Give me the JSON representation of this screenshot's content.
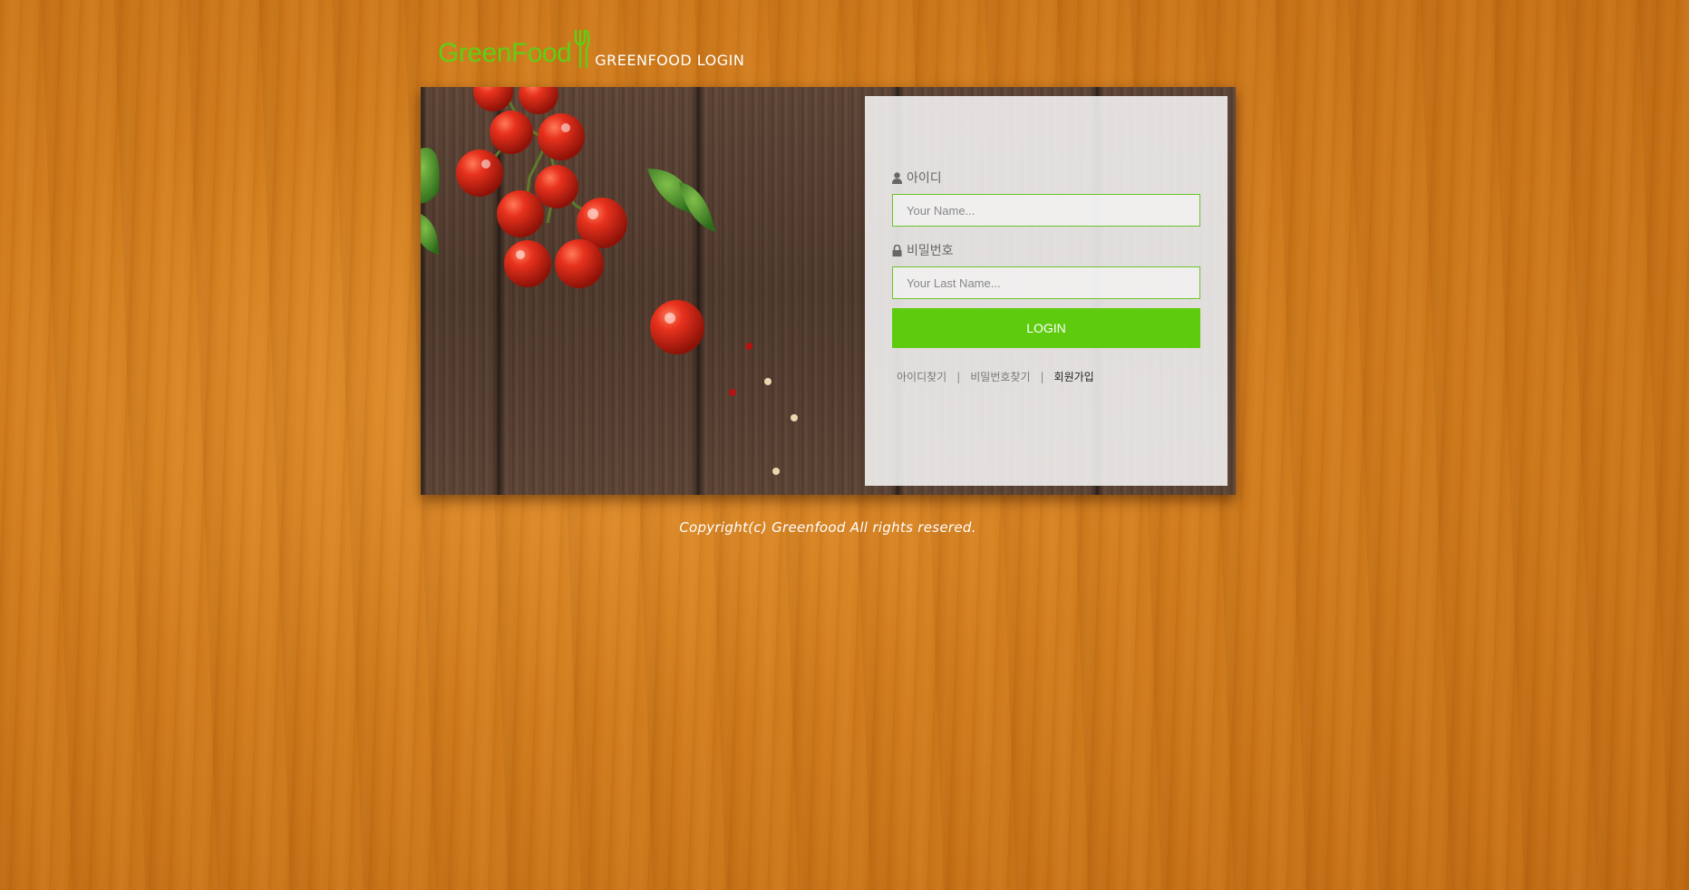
{
  "header": {
    "logo_text": "GreenFood",
    "title": "GREENFOOD LOGIN"
  },
  "login_form": {
    "id_label": "아이디",
    "id_placeholder": "Your Name...",
    "password_label": "비밀번호",
    "password_placeholder": "Your Last Name...",
    "login_button": "LOGIN",
    "links": [
      {
        "label": "아이디찾기"
      },
      {
        "label": "비밀번호찾기"
      },
      {
        "label": "회원가입"
      }
    ],
    "separator": "|"
  },
  "footer": {
    "copyright": "Copyright(c) Greenfood All rights resered."
  },
  "colors": {
    "accent": "#5ecb0f",
    "background_wood": "#d07a1c",
    "panel": "#f5f5f5"
  },
  "icons": [
    "user-icon",
    "lock-icon",
    "fork-icon"
  ]
}
